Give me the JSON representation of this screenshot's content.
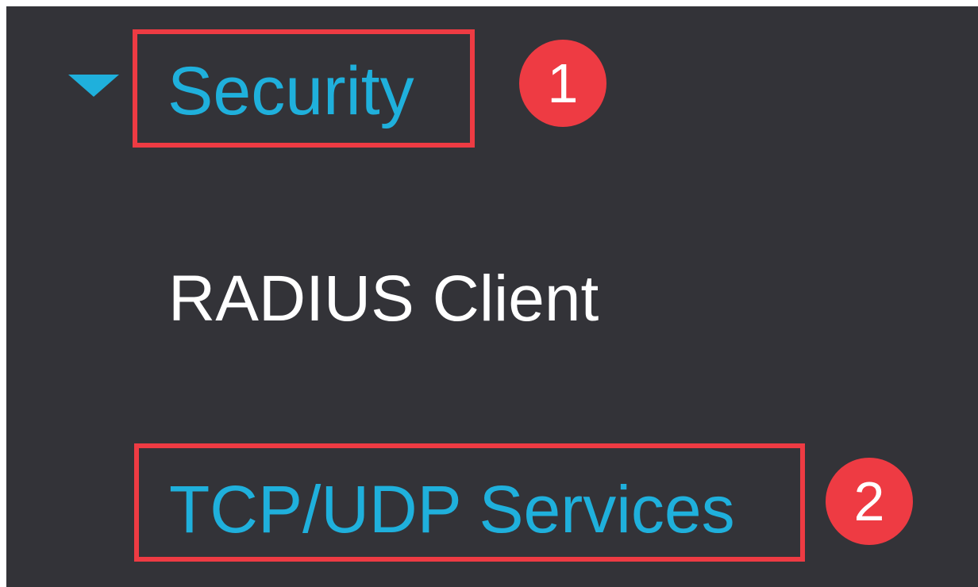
{
  "sidebar": {
    "section": {
      "label": "Security",
      "expanded": true,
      "icon": "caret-down-icon"
    },
    "items": [
      {
        "label": "RADIUS Client"
      },
      {
        "label": "TCP/UDP Services"
      }
    ]
  },
  "annotations": {
    "steps": [
      "1",
      "2"
    ],
    "highlight_color": "#ee3b43"
  },
  "colors": {
    "background": "#333338",
    "accent": "#1fb0dc",
    "text": "#ffffff"
  }
}
